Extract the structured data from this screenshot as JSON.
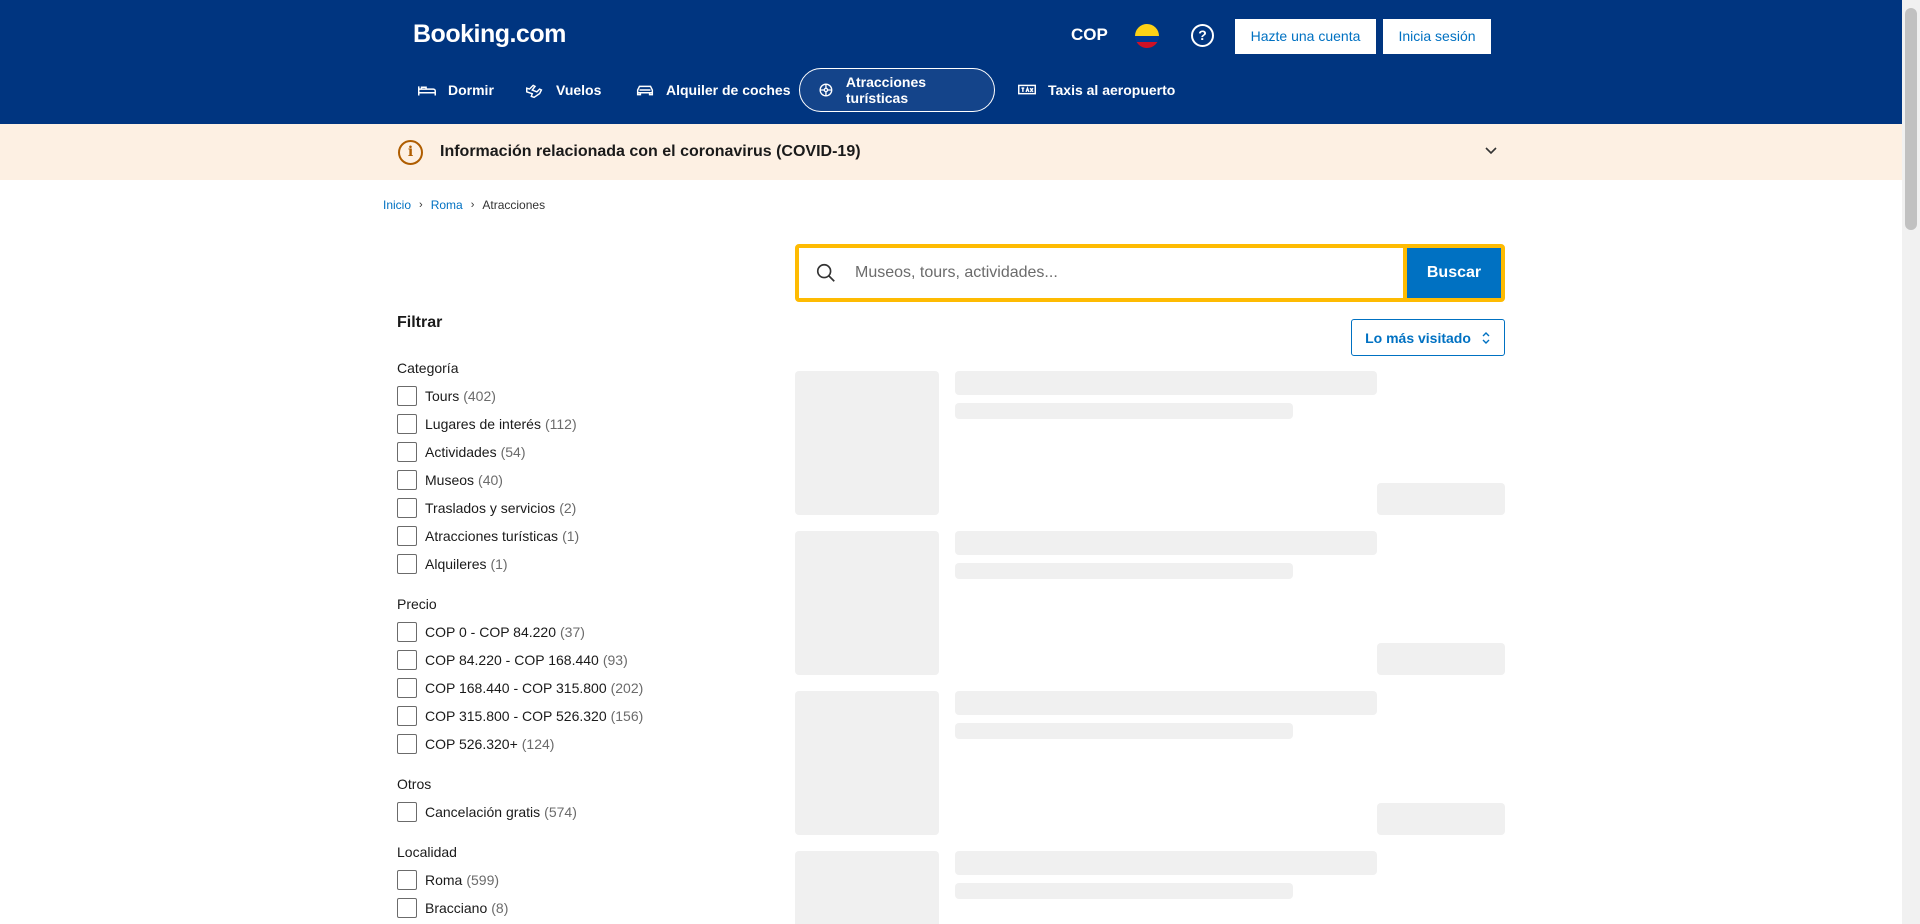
{
  "header": {
    "logo": "Booking.com",
    "currency": "COP",
    "help_glyph": "?",
    "register_label": "Hazte una cuenta",
    "login_label": "Inicia sesión",
    "nav": [
      {
        "label": "Dormir",
        "icon": "bed-icon"
      },
      {
        "label": "Vuelos",
        "icon": "plane-icon"
      },
      {
        "label": "Alquiler de coches",
        "icon": "car-icon"
      },
      {
        "label": "Atracciones turísticas",
        "icon": "attractions-icon",
        "active": true
      },
      {
        "label": "Taxis al aeropuerto",
        "icon": "taxi-icon"
      }
    ]
  },
  "banner": {
    "text": "Información relacionada con el coronavirus (COVID-19)",
    "icon": "info-icon"
  },
  "breadcrumb": {
    "items": [
      "Inicio",
      "Roma",
      "Atracciones"
    ]
  },
  "search": {
    "placeholder": "Museos, tours, actividades...",
    "button": "Buscar"
  },
  "sort": {
    "label": "Lo más visitado"
  },
  "filters": {
    "title": "Filtrar",
    "groups": [
      {
        "title": "Categoría",
        "options": [
          {
            "label": "Tours",
            "count": "(402)"
          },
          {
            "label": "Lugares de interés",
            "count": "(112)"
          },
          {
            "label": "Actividades",
            "count": "(54)"
          },
          {
            "label": "Museos",
            "count": "(40)"
          },
          {
            "label": "Traslados y servicios",
            "count": "(2)"
          },
          {
            "label": "Atracciones turísticas",
            "count": "(1)"
          },
          {
            "label": "Alquileres",
            "count": "(1)"
          }
        ]
      },
      {
        "title": "Precio",
        "options": [
          {
            "label": "COP 0 - COP 84.220",
            "count": "(37)"
          },
          {
            "label": "COP 84.220 - COP 168.440",
            "count": "(93)"
          },
          {
            "label": "COP 168.440 - COP 315.800",
            "count": "(202)"
          },
          {
            "label": "COP 315.800 - COP 526.320",
            "count": "(156)"
          },
          {
            "label": "COP 526.320+",
            "count": "(124)"
          }
        ]
      },
      {
        "title": "Otros",
        "options": [
          {
            "label": "Cancelación gratis",
            "count": "(574)"
          }
        ]
      },
      {
        "title": "Localidad",
        "options": [
          {
            "label": "Roma",
            "count": "(599)"
          },
          {
            "label": "Bracciano",
            "count": "(8)"
          }
        ]
      }
    ]
  },
  "colors": {
    "brand": "#003580",
    "accent": "#0071c2",
    "search_border": "#febb02",
    "banner_bg": "#fdf0e3"
  }
}
